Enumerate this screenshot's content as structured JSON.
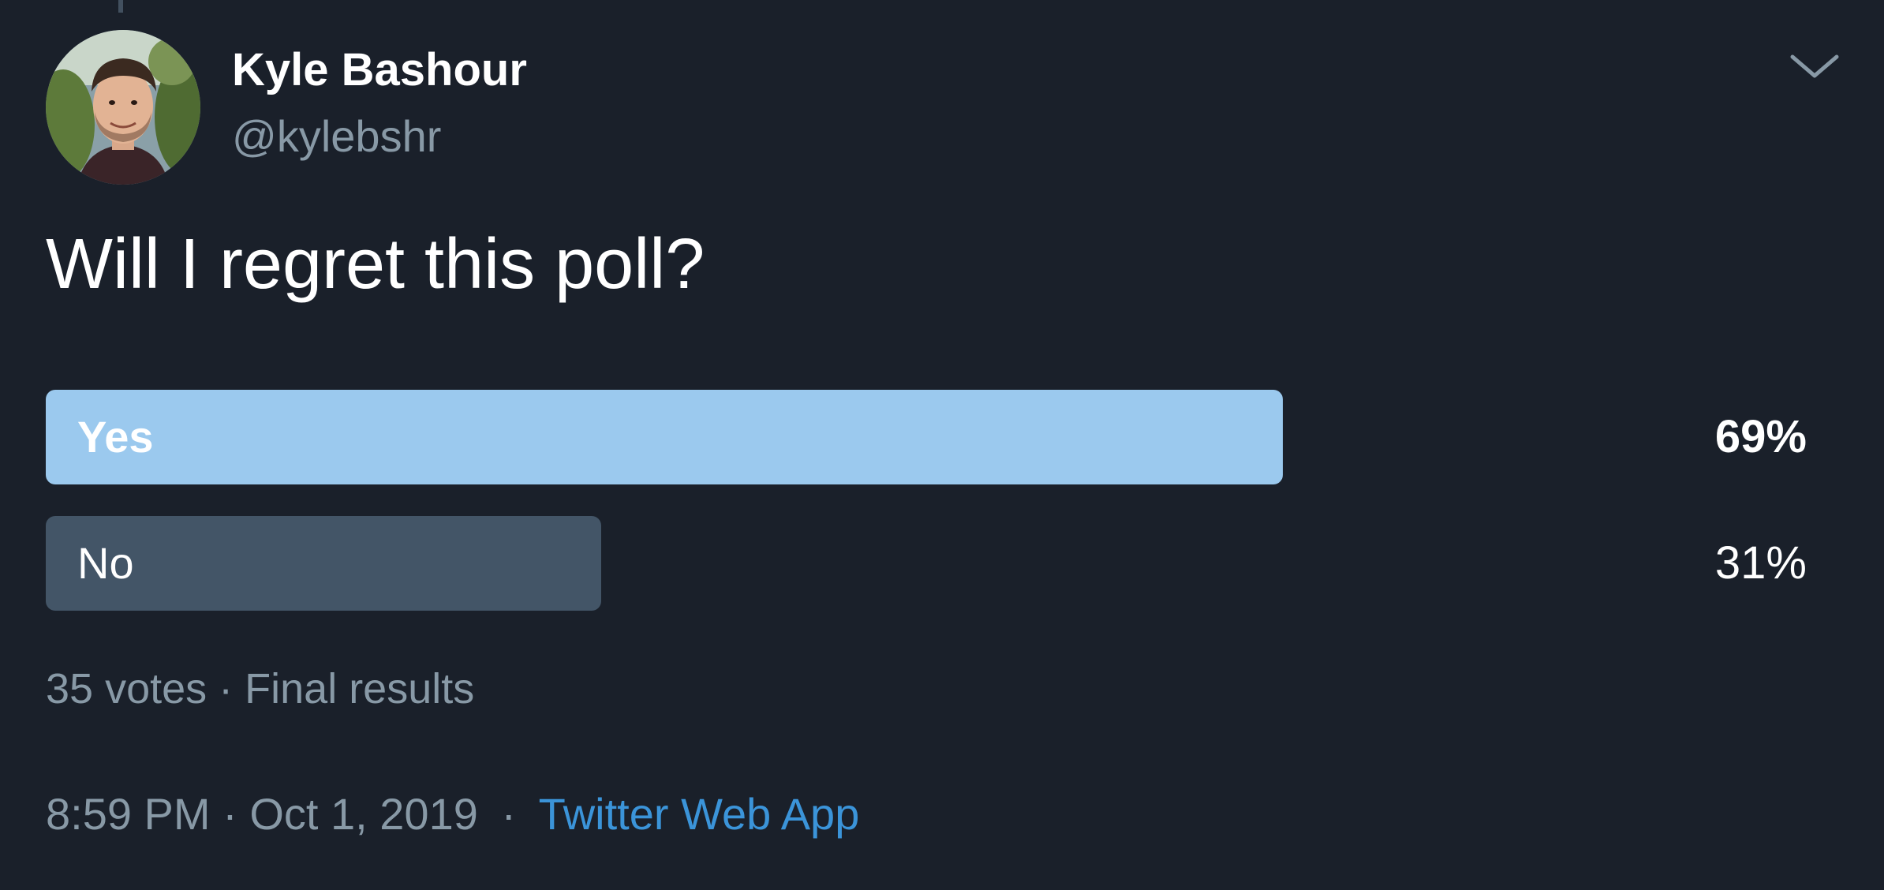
{
  "tweet": {
    "author": {
      "display_name": "Kyle Bashour",
      "handle": "@kylebshr",
      "avatar_icon": "avatar-photo"
    },
    "menu_icon": "chevron-down-icon",
    "text": "Will I regret this poll?",
    "poll": {
      "options": [
        {
          "label": "Yes",
          "percent_text": "69%",
          "share": 0.69,
          "winner": true
        },
        {
          "label": "No",
          "percent_text": "31%",
          "share": 0.31,
          "winner": false
        }
      ],
      "votes_text": "35 votes",
      "separator": "·",
      "status_text": "Final results"
    },
    "time": "8:59 PM",
    "date": "Oct 1, 2019",
    "separator": "·",
    "source": "Twitter Web App"
  },
  "colors": {
    "background": "#1a202a",
    "winner_bar": "#9bc9ee",
    "loser_bar": "#435567",
    "secondary_text": "#8899a6",
    "link": "#3b94d9"
  }
}
